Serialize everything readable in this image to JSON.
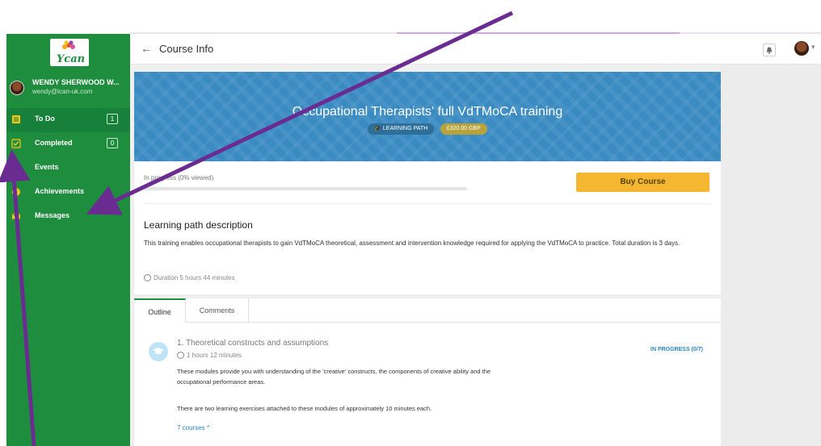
{
  "user": {
    "name": "WENDY SHERWOOD W...",
    "email": "wendy@ican-uk.com"
  },
  "logo": {
    "text": "Ycan"
  },
  "sidebar": {
    "items": [
      {
        "label": "To Do",
        "count": "1",
        "icon": "list-icon"
      },
      {
        "label": "Completed",
        "count": "0",
        "icon": "check-icon"
      },
      {
        "label": "Events",
        "count": "",
        "icon": "calendar-icon"
      },
      {
        "label": "Achievements",
        "count": "",
        "icon": "trophy-icon"
      },
      {
        "label": "Messages",
        "count": "",
        "icon": "envelope-icon"
      }
    ]
  },
  "header": {
    "title": "Course Info",
    "back_icon": "←"
  },
  "banner": {
    "title": "Occupational Therapists' full VdTMoCA training",
    "path_badge": "🎓 LEARNING PATH",
    "price_badge": "£320.00 GBP"
  },
  "progress": {
    "label": "In progress (0% viewed)",
    "fraction": 0
  },
  "buy_button": "Buy Course",
  "description": {
    "title": "Learning path description",
    "body": "This training enables occupational therapists to gain VdTMoCA theoretical, assessment and intervention knowledge required for applying the VdTMoCA to practice. Total duration is 3 days.",
    "duration": "Duration 5 hours 44 minutes"
  },
  "tabs": [
    "Outline",
    "Comments"
  ],
  "module": {
    "title": "1. Theoretical constructs and assumptions",
    "time": "1 hours 12 minutes",
    "status": "IN PROGRESS (0/7)",
    "desc1": "These modules provide you with understanding of the 'creative' constructs, the components of creative ability and the occupational performance areas.",
    "desc2": "There are two learning exercises attached to these modules of approximately 10 minutes each.",
    "courses": "7 courses ^"
  },
  "colors": {
    "sidebar": "#1e8e3e",
    "banner": "#3a8bc2",
    "buy": "#f5b731",
    "annotation_arrow": "#6a2c91"
  }
}
